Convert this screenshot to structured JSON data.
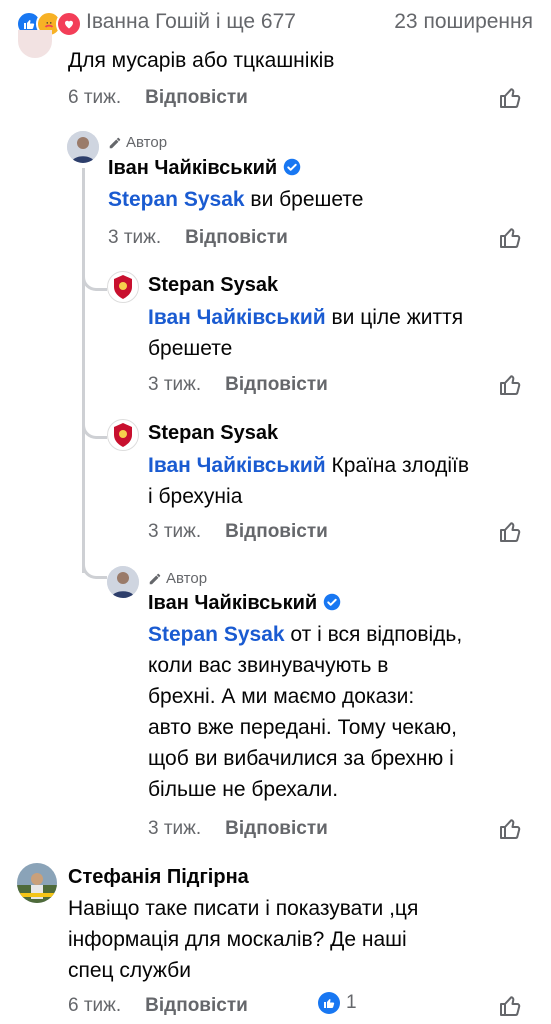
{
  "reactions_bar": {
    "reactors": "Іванна Гошій і ще 677",
    "shares": "23 поширення"
  },
  "comments": [
    {
      "text": "Для мусарів або тцкашніків",
      "time": "6 тиж.",
      "reply": "Відповісти"
    },
    {
      "author_tag": "Автор",
      "name": "Іван Чайківський",
      "mention": "Stepan Sysak",
      "text": " ви брешете",
      "time": "3 тиж.",
      "reply": "Відповісти"
    },
    {
      "name": "Stepan Sysak",
      "mention": "Іван Чайківський",
      "text_line1": " ви ціле життя",
      "text_line2": "брешете",
      "time": "3 тиж.",
      "reply": "Відповісти"
    },
    {
      "name": "Stepan Sysak",
      "mention": "Іван Чайківський",
      "text_line1": " Країна злодіїв",
      "text_line2": "і брехуніа",
      "time": "3 тиж.",
      "reply": "Відповісти"
    },
    {
      "author_tag": "Автор",
      "name": "Іван Чайківський",
      "mention": "Stepan Sysak",
      "text_line1": " от і вся відповідь,",
      "text_line2": "коли вас звинувачують в",
      "text_line3": "брехні. А ми маємо докази:",
      "text_line4": "авто вже передані. Тому чекаю,",
      "text_line5": "щоб ви вибачилися за брехню і",
      "text_line6": "більше не брехали.",
      "time": "3 тиж.",
      "reply": "Відповісти"
    },
    {
      "name": "Стефанія Підгірна",
      "text_line1": "Навіщо таке писати і показувати ,ця",
      "text_line2": "інформація для москалів? Де наші",
      "text_line3": "спец служби",
      "time": "6 тиж.",
      "reply": "Відповісти",
      "like_count": "1"
    }
  ],
  "colors": {
    "accent": "#1877f2",
    "mention": "#1a5bd1",
    "meta": "#65676b",
    "thread": "#ced0d4"
  }
}
